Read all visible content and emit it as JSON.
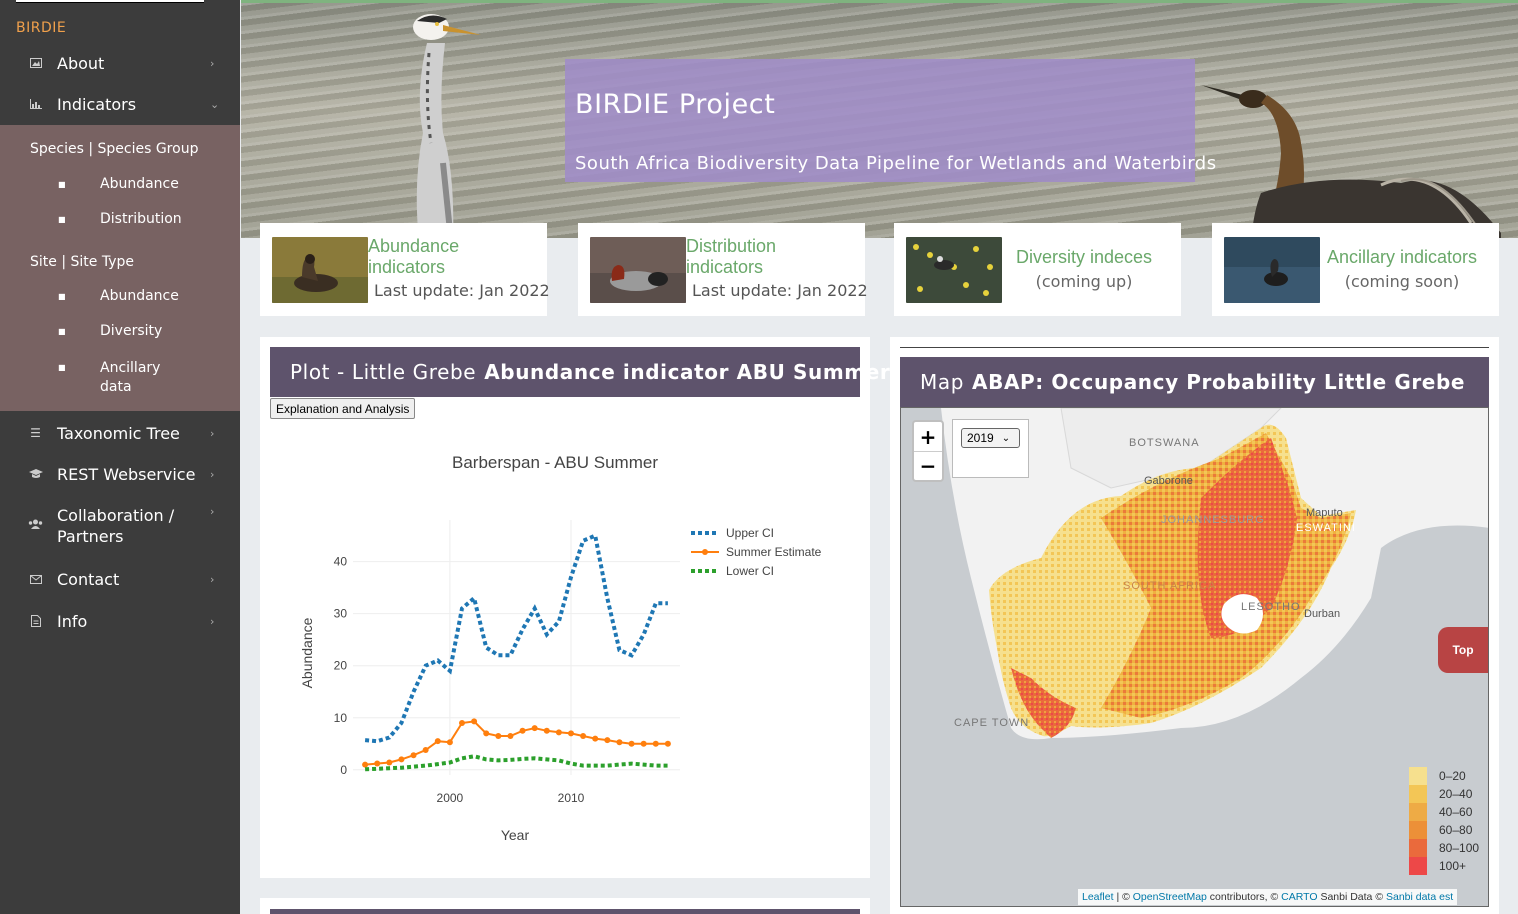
{
  "sidebar": {
    "brand": "BIRDIE",
    "nav": [
      {
        "label": "About",
        "icon": "image-icon"
      },
      {
        "label": "Indicators",
        "icon": "bar-chart-icon"
      },
      {
        "label": "Taxonomic Tree",
        "icon": "list-icon"
      },
      {
        "label": "REST Webservice",
        "icon": "graduation-cap-icon"
      },
      {
        "label": "Collaboration / Partners",
        "icon": "users-icon"
      },
      {
        "label": "Contact",
        "icon": "envelope-icon"
      },
      {
        "label": "Info",
        "icon": "document-icon"
      }
    ],
    "indicators_menu": {
      "group1": "Species | Species Group",
      "group1_items": [
        "Abundance",
        "Distribution"
      ],
      "group2": "Site | Site Type",
      "group2_items": [
        "Abundance",
        "Diversity",
        "Ancillary data"
      ]
    }
  },
  "hero": {
    "title": "BIRDIE Project",
    "subtitle": "South Africa Biodiversity Data Pipeline for Wetlands and Waterbirds"
  },
  "cards": [
    {
      "title": "Abundance indicators",
      "update": "Last update: Jan 2022"
    },
    {
      "title": "Distribution indicators",
      "update": "Last update: Jan 2022"
    },
    {
      "title": "Diversity indeces",
      "sub": "(coming up)"
    },
    {
      "title": "Ancillary indicators",
      "sub": "(coming soon)"
    }
  ],
  "plot_panel": {
    "title_prefix": "Plot - Little Grebe",
    "title_bold": "Abundance indicator ABU Summer",
    "button": "Explanation and Analysis"
  },
  "map_panel": {
    "title_prefix": "Map",
    "title_bold": "ABAP: Occupancy Probability Little Grebe",
    "year": "2019",
    "zoom_in": "+",
    "zoom_out": "−",
    "labels": [
      "BOTSWANA",
      "Gaborone",
      "JOHANNESBURG",
      "Maputo",
      "ESWATINI",
      "SOUTH AFRICA",
      "LESOTHO",
      "Durban",
      "CAPE TOWN"
    ],
    "legend": [
      {
        "label": "0–20",
        "color": "#f6e08e"
      },
      {
        "label": "20–40",
        "color": "#f3c656"
      },
      {
        "label": "40–60",
        "color": "#eeab45"
      },
      {
        "label": "60–80",
        "color": "#ec9038"
      },
      {
        "label": "80–100",
        "color": "#ea6a3c"
      },
      {
        "label": "100+",
        "color": "#ed4848"
      }
    ],
    "attribution": {
      "leaflet": "Leaflet",
      "sep": " | © ",
      "osm": "OpenStreetMap",
      "contrib": " contributors, © ",
      "carto": "CARTO",
      "sanbi": " Sanbi Data © ",
      "sanbi_est": "Sanbi data est"
    }
  },
  "top_button": "Top",
  "chart_data": {
    "type": "line",
    "title": "Barberspan - ABU Summer",
    "xlabel": "Year",
    "ylabel": "Abundance",
    "xticks": [
      2000,
      2010
    ],
    "yticks": [
      0,
      10,
      20,
      30,
      40
    ],
    "xlim": [
      1992,
      2019
    ],
    "ylim": [
      -1,
      48
    ],
    "x": [
      1993,
      1994,
      1995,
      1996,
      1997,
      1998,
      1999,
      2000,
      2001,
      2002,
      2003,
      2004,
      2005,
      2006,
      2007,
      2008,
      2009,
      2010,
      2011,
      2012,
      2013,
      2014,
      2015,
      2016,
      2017,
      2018
    ],
    "series": [
      {
        "name": "Upper CI",
        "color": "#1f77b4",
        "dash": true,
        "values": [
          5.7,
          5.5,
          6.2,
          9,
          15,
          20,
          21,
          19,
          31,
          33,
          23.5,
          22,
          22,
          27,
          31,
          26,
          28.5,
          37,
          44,
          45,
          33,
          23,
          22,
          26,
          32,
          32
        ]
      },
      {
        "name": "Summer Estimate",
        "color": "#ff7f0e",
        "dash": false,
        "markers": true,
        "values": [
          1,
          1.2,
          1.4,
          2,
          2.8,
          3.8,
          5.5,
          5.3,
          9,
          9.3,
          7,
          6.5,
          6.5,
          7.5,
          8,
          7.5,
          7.2,
          7,
          6.5,
          6,
          5.7,
          5.3,
          5,
          5,
          5,
          5
        ]
      },
      {
        "name": "Lower CI",
        "color": "#2ca02c",
        "dash": true,
        "values": [
          0.1,
          0.2,
          0.3,
          0.4,
          0.6,
          0.8,
          1.1,
          1.4,
          2.2,
          2.6,
          2,
          1.8,
          1.9,
          2.1,
          2.2,
          2,
          1.8,
          1.2,
          0.8,
          0.8,
          0.8,
          1,
          1.2,
          1,
          0.8,
          0.8
        ]
      }
    ]
  }
}
